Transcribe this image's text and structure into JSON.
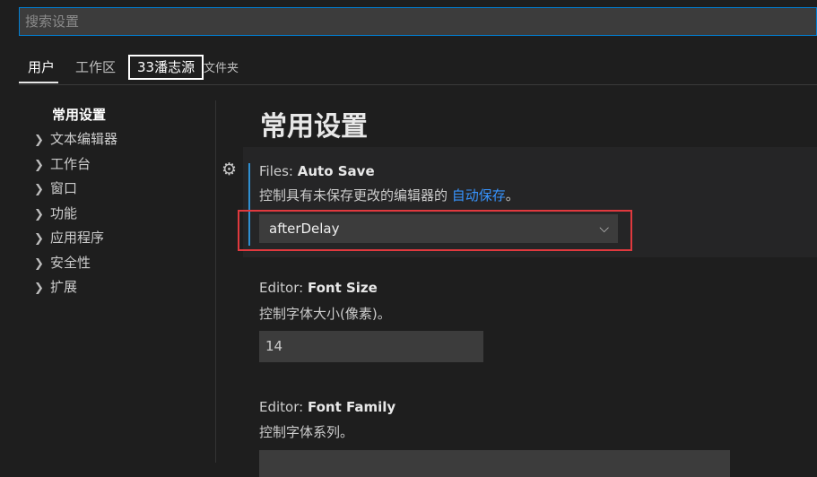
{
  "search": {
    "placeholder": "搜索设置"
  },
  "tabs": [
    {
      "label": "用户"
    },
    {
      "label": "工作区"
    },
    {
      "label": "33潘志源"
    },
    {
      "label": "文件夹"
    }
  ],
  "toc": {
    "selected": "常用设置",
    "items": [
      "文本编辑器",
      "工作台",
      "窗口",
      "功能",
      "应用程序",
      "安全性",
      "扩展"
    ]
  },
  "main": {
    "title": "常用设置",
    "settings": [
      {
        "category": "Files: ",
        "name": "Auto Save",
        "description": "控制具有未保存更改的编辑器的 ",
        "link": "自动保存",
        "description_end": "。",
        "value": "afterDelay"
      },
      {
        "category": "Editor: ",
        "name": "Font Size",
        "description": "控制字体大小(像素)。",
        "value": "14"
      },
      {
        "category": "Editor: ",
        "name": "Font Family",
        "description": "控制字体系列。",
        "value": ""
      }
    ]
  }
}
